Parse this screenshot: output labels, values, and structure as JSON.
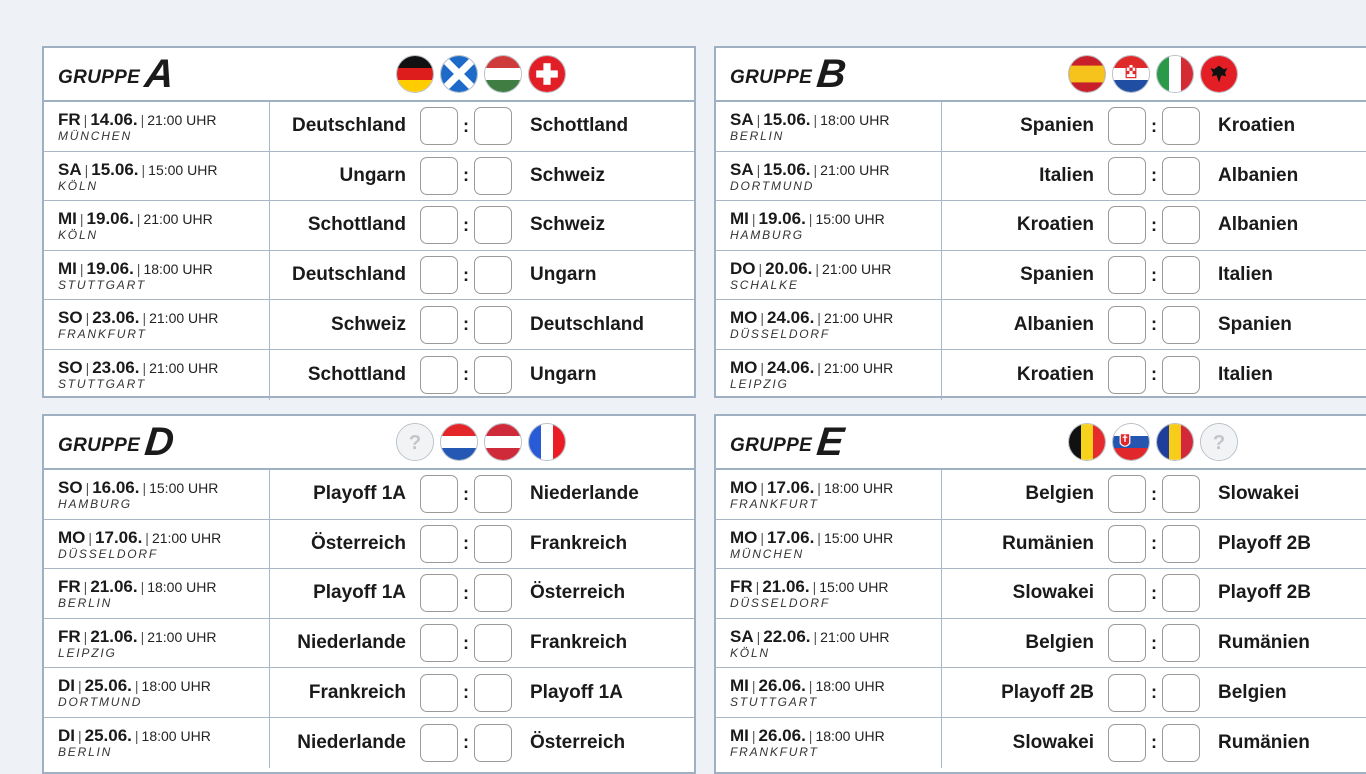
{
  "groups": [
    {
      "word": "GRUPPE",
      "letter": "A",
      "flags": [
        "germany-flag",
        "scotland-flag",
        "hungary-flag",
        "switzerland-flag"
      ],
      "matches": [
        {
          "day": "FR",
          "date": "14.06.",
          "time": "21:00 UHR",
          "venue": "München",
          "home": "Deutschland",
          "away": "Schottland"
        },
        {
          "day": "SA",
          "date": "15.06.",
          "time": "15:00 UHR",
          "venue": "Köln",
          "home": "Ungarn",
          "away": "Schweiz"
        },
        {
          "day": "MI",
          "date": "19.06.",
          "time": "21:00 UHR",
          "venue": "Köln",
          "home": "Schottland",
          "away": "Schweiz"
        },
        {
          "day": "MI",
          "date": "19.06.",
          "time": "18:00 UHR",
          "venue": "Stuttgart",
          "home": "Deutschland",
          "away": "Ungarn"
        },
        {
          "day": "SO",
          "date": "23.06.",
          "time": "21:00 UHR",
          "venue": "Frankfurt",
          "home": "Schweiz",
          "away": "Deutschland"
        },
        {
          "day": "SO",
          "date": "23.06.",
          "time": "21:00 UHR",
          "venue": "Stuttgart",
          "home": "Schottland",
          "away": "Ungarn"
        }
      ]
    },
    {
      "word": "GRUPPE",
      "letter": "B",
      "flags": [
        "spain-flag",
        "croatia-flag",
        "italy-flag",
        "albania-flag"
      ],
      "matches": [
        {
          "day": "SA",
          "date": "15.06.",
          "time": "18:00 UHR",
          "venue": "Berlin",
          "home": "Spanien",
          "away": "Kroatien"
        },
        {
          "day": "SA",
          "date": "15.06.",
          "time": "21:00 UHR",
          "venue": "Dortmund",
          "home": "Italien",
          "away": "Albanien"
        },
        {
          "day": "MI",
          "date": "19.06.",
          "time": "15:00 UHR",
          "venue": "Hamburg",
          "home": "Kroatien",
          "away": "Albanien"
        },
        {
          "day": "DO",
          "date": "20.06.",
          "time": "21:00 UHR",
          "venue": "Schalke",
          "home": "Spanien",
          "away": "Italien"
        },
        {
          "day": "MO",
          "date": "24.06.",
          "time": "21:00 UHR",
          "venue": "Düsseldorf",
          "home": "Albanien",
          "away": "Spanien"
        },
        {
          "day": "MO",
          "date": "24.06.",
          "time": "21:00 UHR",
          "venue": "Leipzig",
          "home": "Kroatien",
          "away": "Italien"
        }
      ]
    },
    {
      "word": "GRUPPE",
      "letter": "D",
      "flags": [
        "unknown-flag",
        "netherlands-flag",
        "austria-flag",
        "france-flag"
      ],
      "matches": [
        {
          "day": "SO",
          "date": "16.06.",
          "time": "15:00 UHR",
          "venue": "Hamburg",
          "home": "Playoff 1A",
          "away": "Niederlande"
        },
        {
          "day": "MO",
          "date": "17.06.",
          "time": "21:00 UHR",
          "venue": "Düsseldorf",
          "home": "Österreich",
          "away": "Frankreich"
        },
        {
          "day": "FR",
          "date": "21.06.",
          "time": "18:00 UHR",
          "venue": "Berlin",
          "home": "Playoff 1A",
          "away": "Österreich"
        },
        {
          "day": "FR",
          "date": "21.06.",
          "time": "21:00 UHR",
          "venue": "Leipzig",
          "home": "Niederlande",
          "away": "Frankreich"
        },
        {
          "day": "DI",
          "date": "25.06.",
          "time": "18:00 UHR",
          "venue": "Dortmund",
          "home": "Frankreich",
          "away": "Playoff 1A"
        },
        {
          "day": "DI",
          "date": "25.06.",
          "time": "18:00 UHR",
          "venue": "Berlin",
          "home": "Niederlande",
          "away": "Österreich"
        }
      ]
    },
    {
      "word": "GRUPPE",
      "letter": "E",
      "flags": [
        "belgium-flag",
        "slovakia-flag",
        "romania-flag",
        "unknown-flag"
      ],
      "matches": [
        {
          "day": "MO",
          "date": "17.06.",
          "time": "18:00 UHR",
          "venue": "Frankfurt",
          "home": "Belgien",
          "away": "Slowakei"
        },
        {
          "day": "MO",
          "date": "17.06.",
          "time": "15:00 UHR",
          "venue": "München",
          "home": "Rumänien",
          "away": "Playoff 2B"
        },
        {
          "day": "FR",
          "date": "21.06.",
          "time": "15:00 UHR",
          "venue": "Düsseldorf",
          "home": "Slowakei",
          "away": "Playoff 2B"
        },
        {
          "day": "SA",
          "date": "22.06.",
          "time": "21:00 UHR",
          "venue": "Köln",
          "home": "Belgien",
          "away": "Rumänien"
        },
        {
          "day": "MI",
          "date": "26.06.",
          "time": "18:00 UHR",
          "venue": "Stuttgart",
          "home": "Playoff 2B",
          "away": "Belgien"
        },
        {
          "day": "MI",
          "date": "26.06.",
          "time": "18:00 UHR",
          "venue": "Frankfurt",
          "home": "Slowakei",
          "away": "Rumänien"
        }
      ]
    }
  ],
  "separator": "|",
  "colon": ":"
}
